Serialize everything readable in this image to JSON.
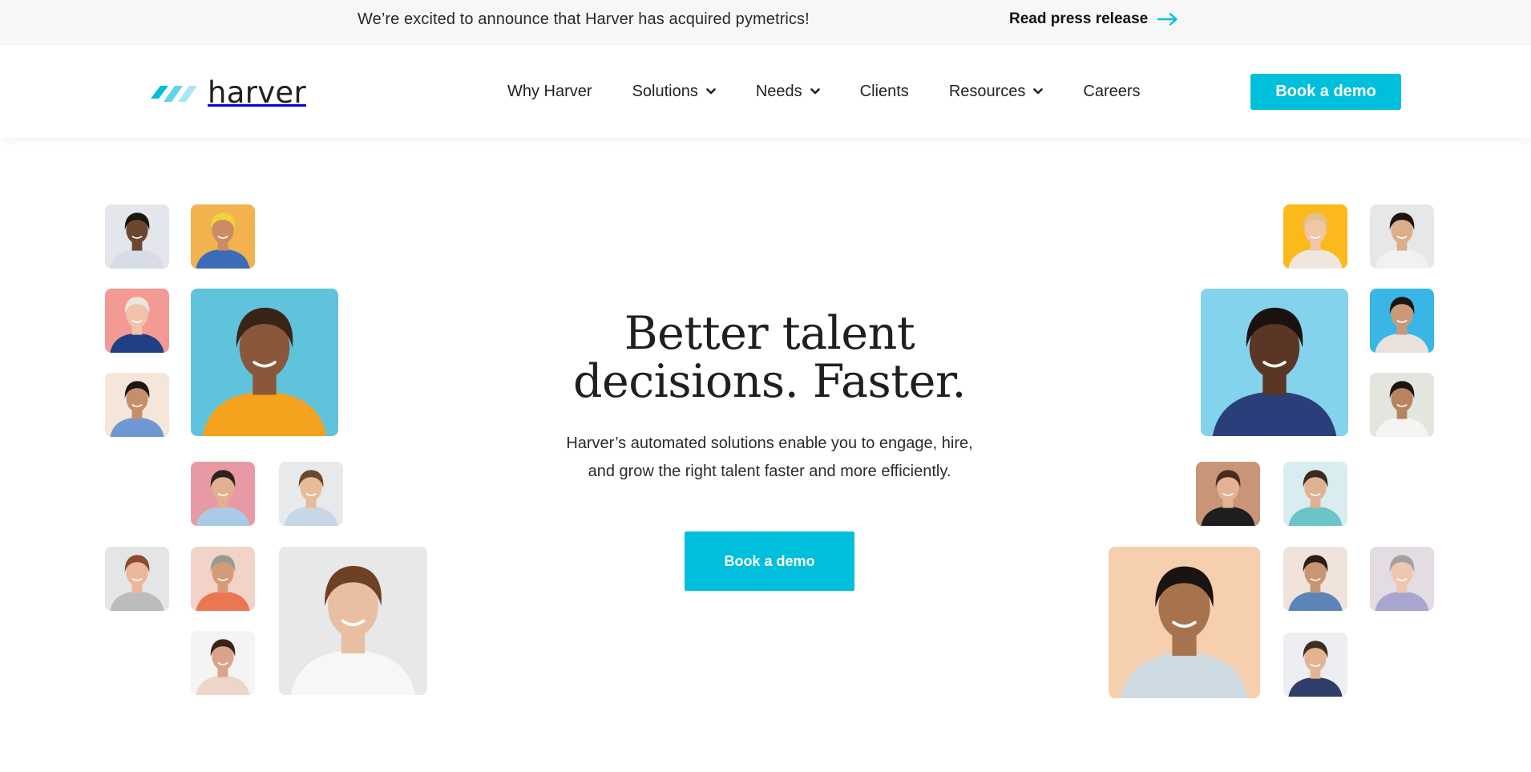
{
  "announcement": {
    "message": "We’re excited to announce that Harver has acquired pymetrics!",
    "link_label": "Read press release",
    "link_icon": "arrow-right-icon"
  },
  "header": {
    "logo_text": "harver",
    "nav": [
      {
        "label": "Why Harver",
        "dropdown": false
      },
      {
        "label": "Solutions",
        "dropdown": true
      },
      {
        "label": "Needs",
        "dropdown": true
      },
      {
        "label": "Clients",
        "dropdown": false
      },
      {
        "label": "Resources",
        "dropdown": true
      },
      {
        "label": "Careers",
        "dropdown": false
      }
    ],
    "cta_label": "Book a demo"
  },
  "hero": {
    "title_line1": "Better talent",
    "title_line2": "decisions. Faster.",
    "subtitle_line1": "Harver’s automated solutions enable you to engage, hire,",
    "subtitle_line2": "and grow the right talent faster and more efficiently.",
    "cta_label": "Book a demo"
  },
  "colors": {
    "accent": "#00bfdc",
    "text": "#1f1f1f",
    "announcement_bg": "#f7f7f7"
  },
  "photos": {
    "left": [
      {
        "bg": "#e3e6ea",
        "skin": "#6b4630",
        "hair": "#1c140f",
        "shirt": "#d6dde6"
      },
      {
        "bg": "#f2b24e",
        "skin": "#c98c64",
        "hair": "#f0d33c",
        "shirt": "#3c6cb8"
      },
      {
        "bg": "#f39a95",
        "skin": "#f0c4ac",
        "hair": "#e9e6df",
        "shirt": "#1f3f86"
      },
      {
        "bg": "#5fc3dc",
        "skin": "#8a573a",
        "hair": "#3a2416",
        "shirt": "#f5a21f"
      },
      {
        "bg": "#f4e6da",
        "skin": "#c58f6c",
        "hair": "#20160f",
        "shirt": "#6e98d4"
      },
      {
        "bg": "#e79aa3",
        "skin": "#e2b08e",
        "hair": "#2e241e",
        "shirt": "#a9cbe8"
      },
      {
        "bg": "#e7e9ea",
        "skin": "#e7bb98",
        "hair": "#6a4a2c",
        "shirt": "#c7d7e6"
      },
      {
        "bg": "#e3e5e6",
        "skin": "#eab79c",
        "hair": "#8a4b2e",
        "shirt": "#bcbcbc"
      },
      {
        "bg": "#f1d3c7",
        "skin": "#d59a78",
        "hair": "#9a9a94",
        "shirt": "#ea7654"
      },
      {
        "bg": "#e8e8e8",
        "skin": "#e9bfa3",
        "hair": "#6e4025",
        "shirt": "#f7f7f5"
      },
      {
        "bg": "#f4f4f4",
        "skin": "#d9a48a",
        "hair": "#3a2418",
        "shirt": "#ecd6c7"
      }
    ],
    "right": [
      {
        "bg": "#fbb91c",
        "skin": "#f0c6a6",
        "hair": "#e3c08a",
        "shirt": "#f1e6de"
      },
      {
        "bg": "#e6e7e9",
        "skin": "#dcae8c",
        "hair": "#1a1512",
        "shirt": "#f1f1f1"
      },
      {
        "bg": "#83d3ec",
        "skin": "#5b3624",
        "hair": "#1a120e",
        "shirt": "#2a3e7a"
      },
      {
        "bg": "#39b6e6",
        "skin": "#c99a7a",
        "hair": "#1b130f",
        "shirt": "#e9e1dc"
      },
      {
        "bg": "#e2e6df",
        "skin": "#b88360",
        "hair": "#1d1510",
        "shirt": "#f4f4f2"
      },
      {
        "bg": "#c99577",
        "skin": "#e3b294",
        "hair": "#4a2a1c",
        "shirt": "#1e1e1e"
      },
      {
        "bg": "#d9ecef",
        "skin": "#e0b291",
        "hair": "#3b2a20",
        "shirt": "#6ac4c8"
      },
      {
        "bg": "#f6cfae",
        "skin": "#a7734f",
        "hair": "#1a1310",
        "shirt": "#cfdbe3"
      },
      {
        "bg": "#f0e3dc",
        "skin": "#c99572",
        "hair": "#2a1d15",
        "shirt": "#5c84b8"
      },
      {
        "bg": "#e3dde3",
        "skin": "#efc7b0",
        "hair": "#a4a0a0",
        "shirt": "#a8a6ce"
      },
      {
        "bg": "#eceef2",
        "skin": "#e4b492",
        "hair": "#3c2e24",
        "shirt": "#2f3e66"
      }
    ]
  }
}
